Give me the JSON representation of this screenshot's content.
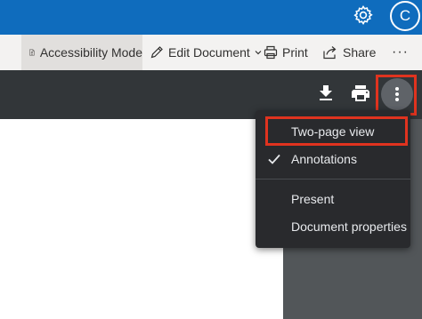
{
  "header": {
    "settings_icon": "gear-icon",
    "avatar_initial": "C",
    "brand_color": "#0f6cbd"
  },
  "toolbar": {
    "accessibility_label": "Accessibility Mode",
    "edit_label": "Edit Document",
    "print_label": "Print",
    "share_label": "Share",
    "more_label": "···"
  },
  "viewer": {
    "download_icon": "download-icon",
    "print_icon": "printer-icon",
    "more_icon": "more-vert-icon"
  },
  "menu": {
    "items": [
      {
        "label": "Two-page view",
        "checked": false
      },
      {
        "label": "Annotations",
        "checked": true
      },
      {
        "label": "Present",
        "checked": false
      },
      {
        "label": "Document properties",
        "checked": false
      }
    ]
  },
  "highlight_color": "#e0331f"
}
